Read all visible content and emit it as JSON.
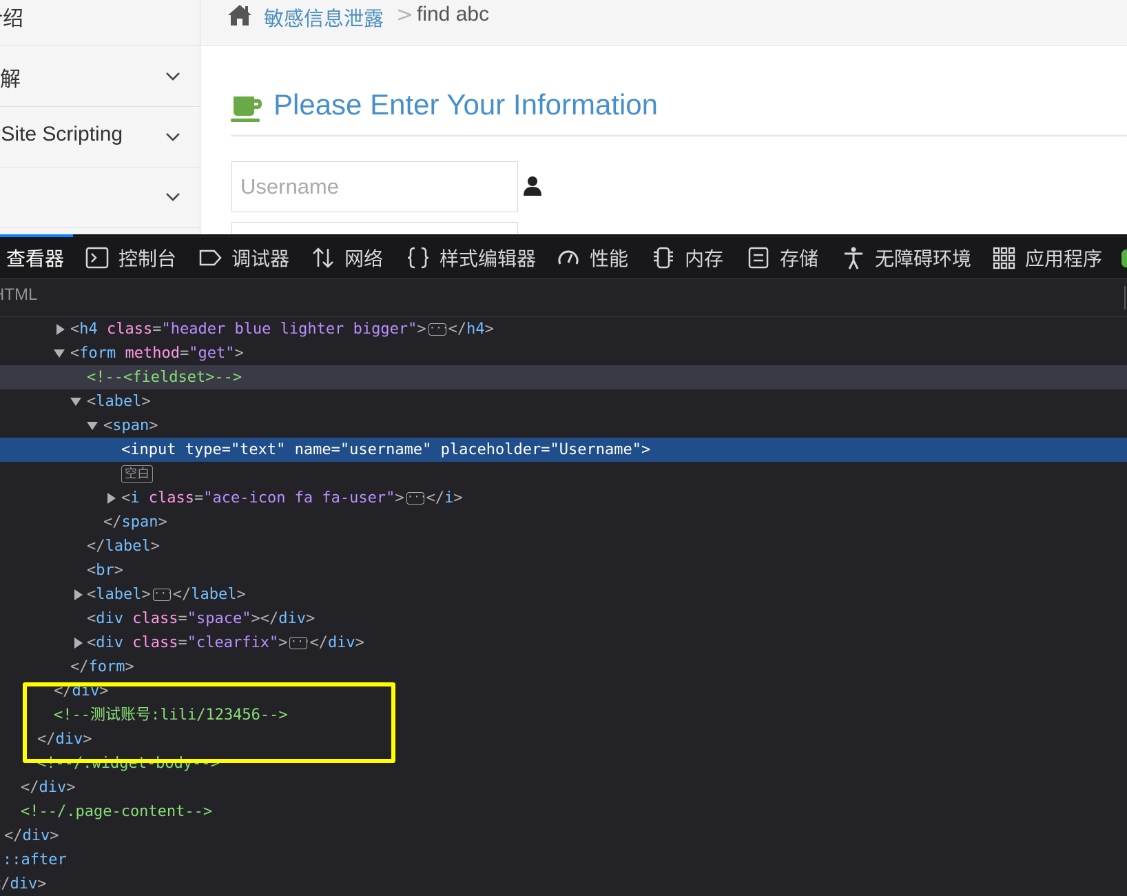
{
  "sidebar": {
    "items": [
      {
        "label": "介绍"
      },
      {
        "label": "破解"
      },
      {
        "label": "Cross-Site Scripting"
      },
      {
        "label": ""
      }
    ]
  },
  "breadcrumb": {
    "link": "敏感信息泄露",
    "separator": ">",
    "current": "find abc"
  },
  "page": {
    "heading": "Please Enter Your Information",
    "username_placeholder": "Username"
  },
  "devtools": {
    "tabs": [
      {
        "label": "查看器",
        "icon": "inspector-icon",
        "active": true
      },
      {
        "label": "控制台",
        "icon": "console-icon"
      },
      {
        "label": "调试器",
        "icon": "debugger-icon"
      },
      {
        "label": "网络",
        "icon": "network-icon"
      },
      {
        "label": "样式编辑器",
        "icon": "style-editor-icon"
      },
      {
        "label": "性能",
        "icon": "performance-icon"
      },
      {
        "label": "内存",
        "icon": "memory-icon"
      },
      {
        "label": "存储",
        "icon": "storage-icon"
      },
      {
        "label": "无障碍环境",
        "icon": "accessibility-icon"
      },
      {
        "label": "应用程序",
        "icon": "application-icon"
      }
    ],
    "panel_label": "HTML",
    "whitespace_label": "空白",
    "markup": {
      "h4_tag": "h4",
      "h4_attr": "class",
      "h4_val": "\"header blue lighter bigger\"",
      "form_tag": "form",
      "form_attr": "method",
      "form_val": "\"get\"",
      "comment_fieldset": "<!--<fieldset>-->",
      "label_tag": "label",
      "span_tag": "span",
      "input_line": "<input type=\"text\" name=\"username\" placeholder=\"Username\">",
      "i_tag": "i",
      "i_attr": "class",
      "i_val": "\"ace-icon fa fa-user\"",
      "br_tag": "br",
      "div_tag": "div",
      "div_attr": "class",
      "space_val": "\"space\"",
      "clearfix_val": "\"clearfix\"",
      "comment_account": "<!--测试账号:lili/123456-->",
      "comment_widget": "<!--/.widget-body-->",
      "comment_page": "<!--/.page-content-->",
      "after_pseudo": "::after"
    }
  },
  "colors": {
    "accent": "#0a84ff",
    "heading": "#478fca",
    "breadcrumb_link": "#4c8fbd",
    "highlight_box": "#ffff00",
    "selected_row": "#204e8a"
  }
}
